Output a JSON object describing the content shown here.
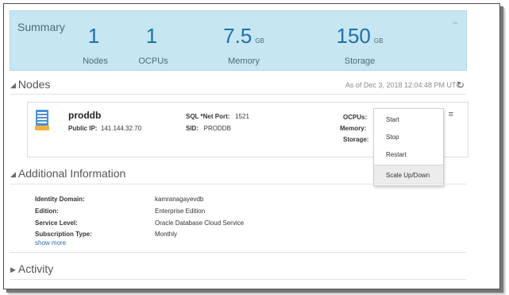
{
  "summary": {
    "title": "Summary",
    "collapse_glyph": "−",
    "metrics": [
      {
        "value": "1",
        "unit": "",
        "label": "Nodes"
      },
      {
        "value": "1",
        "unit": "",
        "label": "OCPUs"
      },
      {
        "value": "7.5",
        "unit": "GB",
        "label": "Memory"
      },
      {
        "value": "150",
        "unit": "GB",
        "label": "Storage"
      }
    ]
  },
  "nodes_section": {
    "title": "Nodes",
    "as_of": "As of Dec 3, 2018 12:04:48 PM UTC",
    "node": {
      "name": "proddb",
      "public_ip_label": "Public IP:",
      "public_ip": "141.144.32.70",
      "sql_port_label": "SQL *Net Port:",
      "sql_port": "1521",
      "sid_label": "SID:",
      "sid": "PRODDB",
      "ocpus_label": "OCPUs:",
      "memory_label": "Memory:",
      "storage_label": "Storage:"
    },
    "menu": [
      "Start",
      "Stop",
      "Restart",
      "Scale Up/Down"
    ]
  },
  "additional_info": {
    "title": "Additional Information",
    "rows": [
      {
        "label": "Identity Domain:",
        "value": "kamranagayevdb"
      },
      {
        "label": "Edition:",
        "value": "Enterprise Edition"
      },
      {
        "label": "Service Level:",
        "value": "Oracle Database Cloud Service"
      },
      {
        "label": "Subscription Type:",
        "value": "Monthly"
      }
    ],
    "show_more": "show more"
  },
  "activity": {
    "title": "Activity"
  },
  "colors": {
    "summary_bg": "#c6e6f2",
    "metric_value": "#1f6fa8",
    "link": "#2a6eb0",
    "db_icon": "#4a90d9",
    "db_icon_base": "#f3b23a"
  },
  "icons": [
    "database-icon",
    "refresh-icon",
    "hamburger-menu-icon",
    "collapse-icon",
    "expand-triangle-icon"
  ]
}
